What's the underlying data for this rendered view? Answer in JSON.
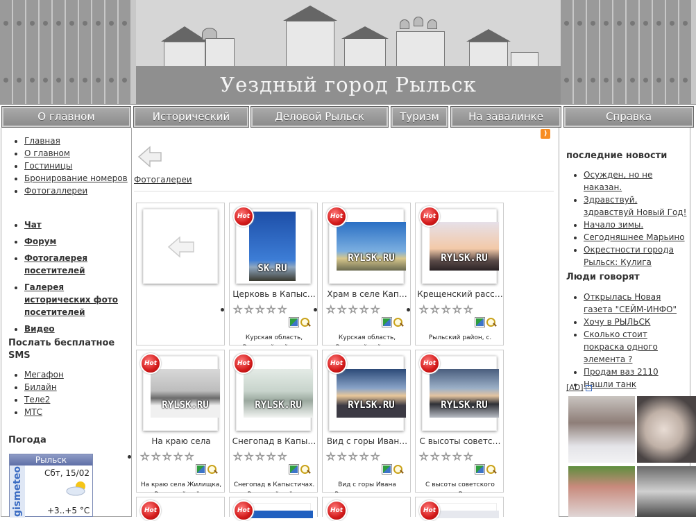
{
  "header": {
    "site_title": "Уездный город Рыльск"
  },
  "nav": {
    "items": [
      "О главном",
      "Исторический",
      "Деловой Рыльск",
      "Туризм",
      "На завалинке",
      "Справка"
    ]
  },
  "left": {
    "menu": [
      "Главная",
      "О главном",
      "Гостиницы",
      "Бронирование номеров",
      "Фотогаллереи"
    ],
    "community": [
      "Чат",
      "Форум",
      "Фотогалерея посетителей",
      "Галерея исторических фото посетителей",
      "Видео"
    ],
    "sms_title": "Послать бесплатное SMS",
    "sms": [
      "Мегафон",
      "Билайн",
      "Теле2",
      "МТС"
    ],
    "weather_title": "Погода",
    "weather": {
      "city": "Рыльск",
      "brand": "gismeteo",
      "date": "Сбт, 15/02",
      "temp": "+3..+5 °C"
    }
  },
  "main": {
    "breadcrumb": "Фотогалереи",
    "hot_label": "Hot",
    "watermark": "RYLSK.RU",
    "watermark_short": "SK.RU",
    "cells": [
      {
        "title": "Церковь в Капыс…",
        "desc": "Курская область, Рыльский район, с."
      },
      {
        "title": "Храм в селе Кап…",
        "desc": "Курская область, Рыльский район, с."
      },
      {
        "title": "Крещенский расс…",
        "desc": "Рыльский район, с."
      },
      {
        "title": "На краю села",
        "desc": "На краю села Жилищка, Рыльский район"
      },
      {
        "title": "Снегопад в Капы…",
        "desc": "Снегопад в Капыстичах. Рыльский район"
      },
      {
        "title": "Вид с горы Иван…",
        "desc": "Вид с горы Ивана Рыльского на закат"
      },
      {
        "title": "С высоты советс…",
        "desc": "С высоты советского прошлого. Вид на село"
      }
    ]
  },
  "right": {
    "news_title": "последние новости",
    "news": [
      "Осужден, но не наказан.",
      "Здравствуй, здравствуй Новый Год!",
      "Начало зимы.",
      "Сегодняшнее Марьино",
      "Окрестности города Рыльск: Кулига"
    ],
    "talk_title": "Люди говорят",
    "talk": [
      "Открылась Новая газета \"СЕЙМ-ИНФО\"",
      "Хочу в РЫЛЬСК",
      "Сколько стоит покраска одного элемента ?",
      "Продам ваз 2110",
      "Нашли танк"
    ],
    "ad_label": "[AD]"
  },
  "colors": {
    "nav_bg": "#999999",
    "hot_badge": "#d31a1a",
    "weather_header": "#6f7fb3"
  }
}
